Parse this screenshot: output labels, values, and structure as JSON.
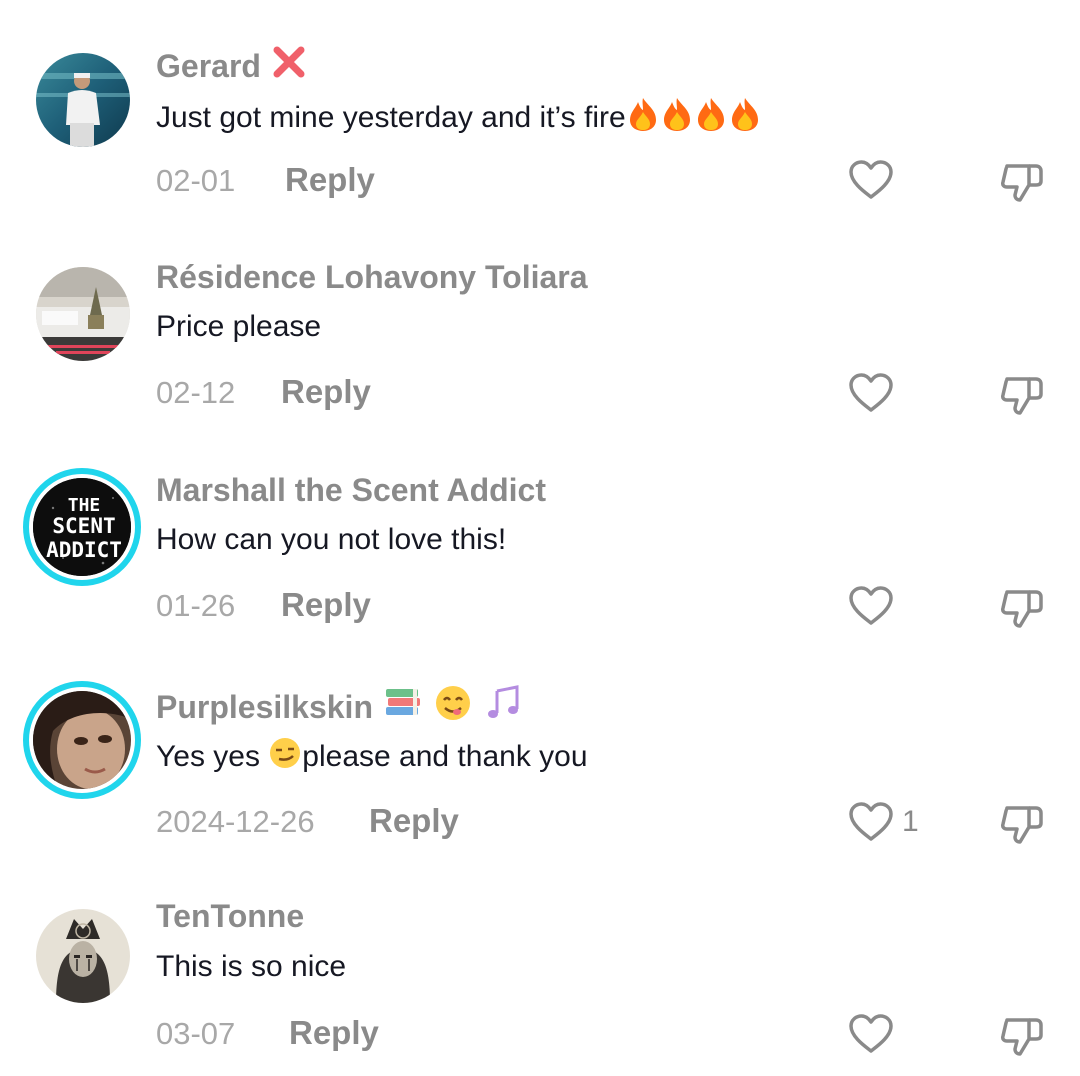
{
  "comments": [
    {
      "username": "Gerard",
      "text": "Just got mine yesterday and it’s fire",
      "date": "02-01",
      "reply_label": "Reply",
      "like_count": "",
      "badge_icon": "cross-mark-icon",
      "trailing_emojis": [
        "fire-emoji",
        "fire-emoji",
        "fire-emoji",
        "fire-emoji"
      ]
    },
    {
      "username": "Résidence Lohavony Toliara",
      "text": "Price please",
      "date": "02-12",
      "reply_label": "Reply",
      "like_count": ""
    },
    {
      "username": "Marshall the Scent Addict",
      "text": "How can you not love this!",
      "date": "01-26",
      "reply_label": "Reply",
      "like_count": "",
      "avatar_text": [
        "THE",
        "SCENT",
        "ADDICT"
      ]
    },
    {
      "username": "Purplesilkskin",
      "text_before": "Yes yes ",
      "text_after": "please and thank you",
      "date": "2024-12-26",
      "reply_label": "Reply",
      "like_count": "1",
      "name_emojis": [
        "books-emoji",
        "yum-face-emoji",
        "music-notes-emoji"
      ],
      "inline_emoji": "smirk-face-emoji"
    },
    {
      "username": "TenTonne",
      "text": "This is so nice",
      "date": "03-07",
      "reply_label": "Reply",
      "like_count": ""
    }
  ],
  "icons": {
    "like": "heart-outline-icon",
    "dislike": "thumbs-down-icon"
  },
  "colors": {
    "username": "#8a8a8a",
    "comment_text": "#161823",
    "meta": "#a8a8a8",
    "story_ring": "#20d5ec"
  }
}
